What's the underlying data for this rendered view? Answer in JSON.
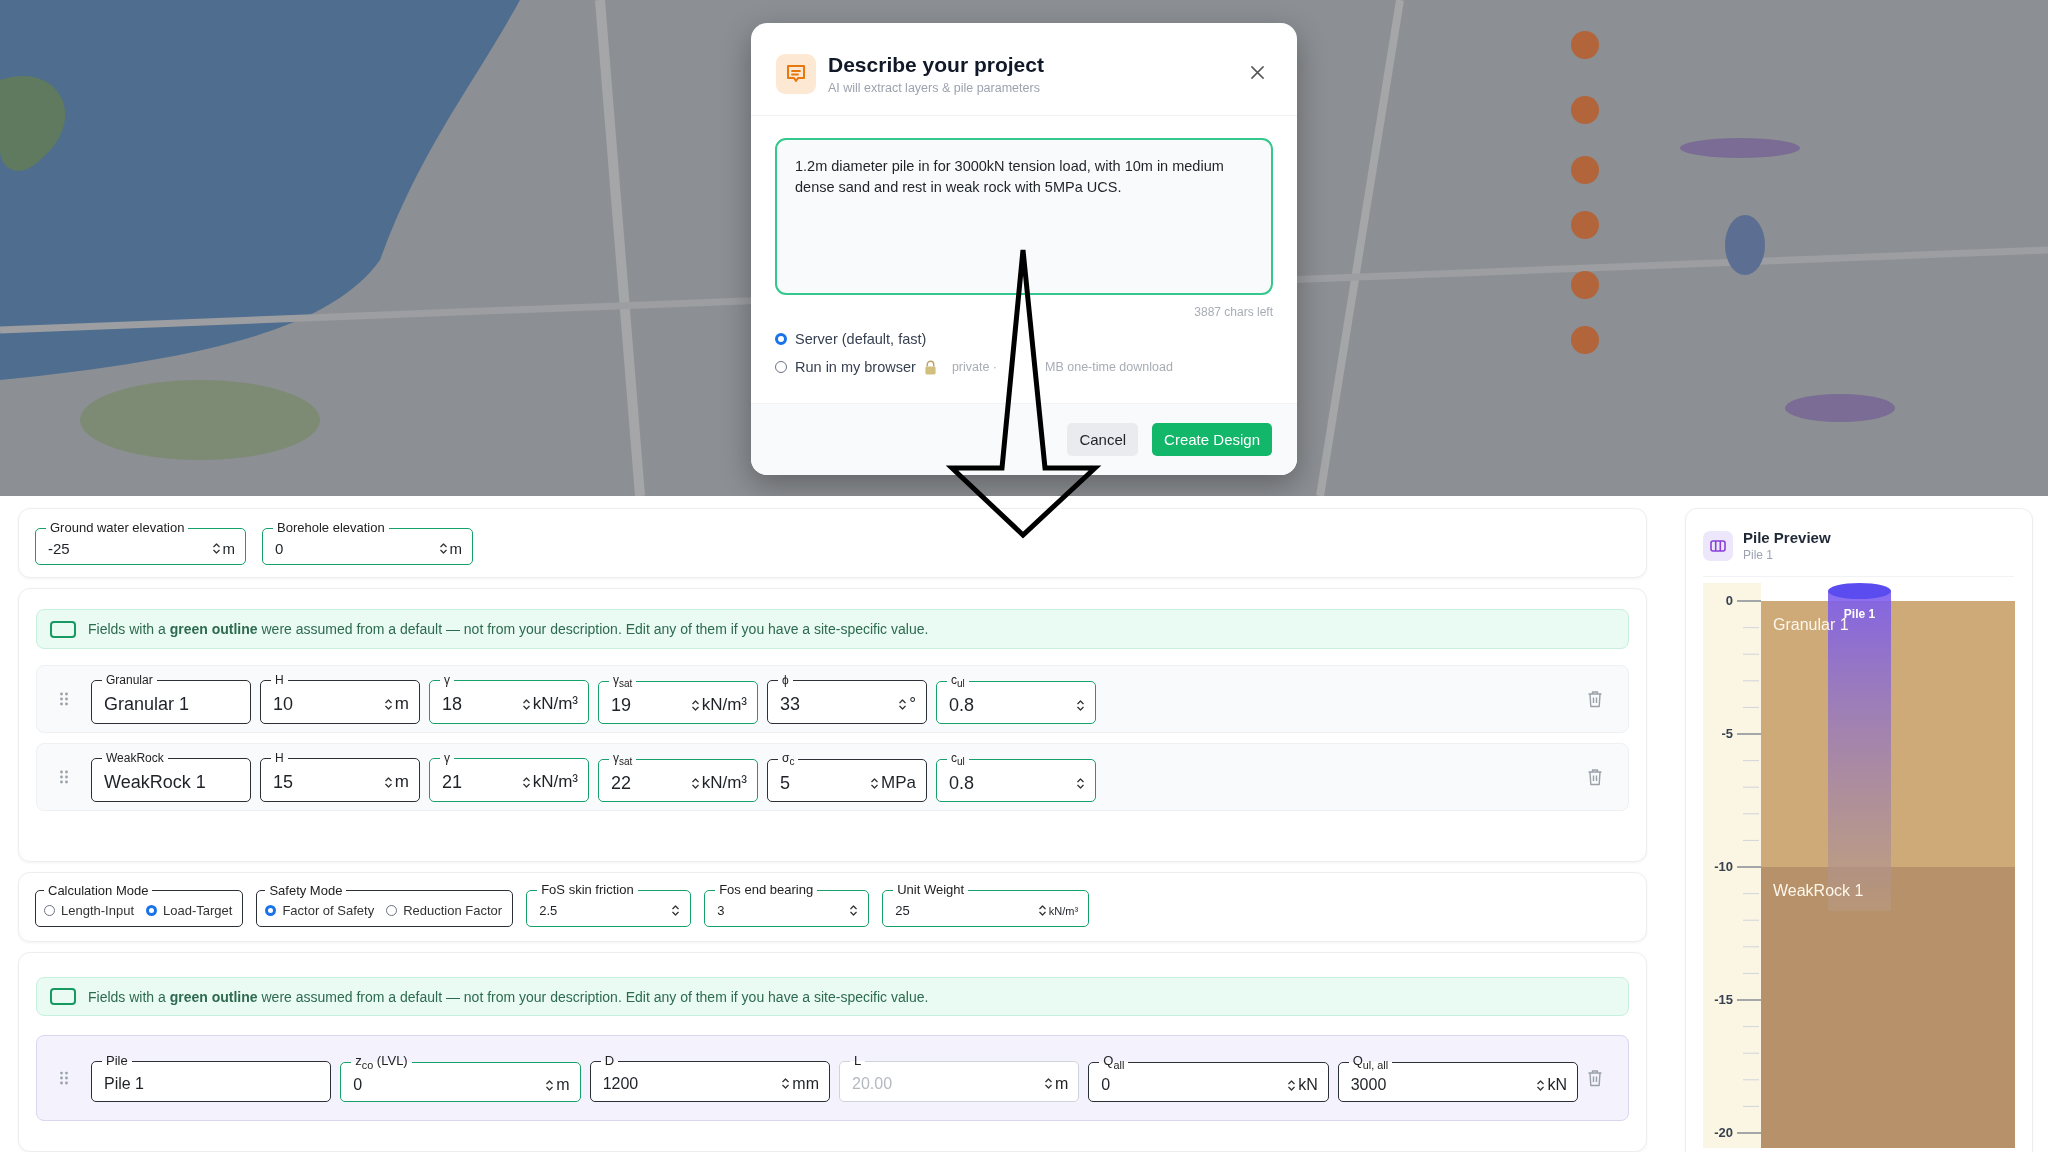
{
  "dialog": {
    "title": "Describe your project",
    "subtitle": "AI will extract layers & pile parameters",
    "description": "1.2m diameter pile in for 3000kN tension load, with 10m in medium dense sand and rest in weak rock with 5MPa UCS.",
    "chars_left": "3887 chars left",
    "run_options": [
      {
        "label": "Server (default, fast)",
        "selected": true,
        "locked": false
      },
      {
        "label": "Run in my browser",
        "selected": false,
        "locked": true,
        "hints": [
          "private ·",
          "MB one-time download"
        ]
      }
    ],
    "buttons": [
      {
        "label": "Cancel",
        "kind": "secondary"
      },
      {
        "label": "Create Design",
        "kind": "primary"
      }
    ]
  },
  "site": {
    "fields": [
      {
        "kind": "number",
        "label": "Ground water elevation",
        "value": "-25",
        "unit": "m",
        "assumed": true
      },
      {
        "kind": "number",
        "label": "Borehole elevation",
        "value": "0",
        "unit": "m",
        "assumed": true
      }
    ]
  },
  "layers": {
    "notice": "Fields with a **green outline** were assumed from a default — not from your description. Edit any of them if you have a site-specific value.",
    "rows": [
      {
        "fields": [
          {
            "kind": "text",
            "label": "Granular",
            "value": "Granular 1",
            "assumed": false
          },
          {
            "kind": "number",
            "label": "H",
            "value": "10",
            "unit": "m",
            "assumed": false
          },
          {
            "kind": "number",
            "label": "γ",
            "value": "18",
            "unit": "kN/m³",
            "assumed": true
          },
          {
            "kind": "number",
            "label": "γ$_{sat}$",
            "value": "19",
            "unit": "kN/m³",
            "assumed": true
          },
          {
            "kind": "number",
            "label": "ϕ",
            "value": "33",
            "unit": "°",
            "assumed": false
          },
          {
            "kind": "number",
            "label": "c$_{ul}$",
            "value": "0.8",
            "assumed": true
          }
        ]
      },
      {
        "fields": [
          {
            "kind": "text",
            "label": "WeakRock",
            "value": "WeakRock 1",
            "assumed": false
          },
          {
            "kind": "number",
            "label": "H",
            "value": "15",
            "unit": "m",
            "assumed": false
          },
          {
            "kind": "number",
            "label": "γ",
            "value": "21",
            "unit": "kN/m³",
            "assumed": true
          },
          {
            "kind": "number",
            "label": "γ$_{sat}$",
            "value": "22",
            "unit": "kN/m³",
            "assumed": true
          },
          {
            "kind": "number",
            "label": "σ$_{c}$",
            "value": "5",
            "unit": "MPa",
            "assumed": false
          },
          {
            "kind": "number",
            "label": "c$_{ul}$",
            "value": "0.8",
            "assumed": true
          }
        ]
      }
    ]
  },
  "settings": {
    "controls": [
      {
        "kind": "radio",
        "label": "Calculation Mode",
        "options": [
          {
            "label": "Length-Input",
            "selected": false
          },
          {
            "label": "Load-Target",
            "selected": true
          }
        ]
      },
      {
        "kind": "radio",
        "label": "Safety Mode",
        "options": [
          {
            "label": "Factor of Safety",
            "selected": true
          },
          {
            "label": "Reduction Factor",
            "selected": false
          }
        ]
      },
      {
        "kind": "number",
        "label": "FoS skin friction",
        "value": "2.5",
        "assumed": true
      },
      {
        "kind": "number",
        "label": "Fos end bearing",
        "value": "3",
        "assumed": true
      },
      {
        "kind": "number",
        "label": "Unit Weight",
        "value": "25",
        "unit": "kN/m³",
        "assumed": true
      }
    ]
  },
  "piles": {
    "notice": "Fields with a **green outline** were assumed from a default — not from your description. Edit any of them if you have a site-specific value.",
    "rows": [
      {
        "fields": [
          {
            "kind": "text",
            "label": "Pile",
            "value": "Pile 1",
            "assumed": false,
            "disabled": false
          },
          {
            "kind": "number",
            "label": "z$_{co}$ (LVL)",
            "value": "0",
            "unit": "m",
            "assumed": true,
            "disabled": false
          },
          {
            "kind": "number",
            "label": "D",
            "value": "1200",
            "unit": "mm",
            "assumed": false,
            "disabled": false
          },
          {
            "kind": "number",
            "label": "L",
            "value": "20.00",
            "unit": "m",
            "assumed": false,
            "disabled": true
          },
          {
            "kind": "number",
            "label": "Q$_{all}$",
            "value": "0",
            "unit": "kN",
            "assumed": false,
            "disabled": false
          },
          {
            "kind": "number",
            "label": "Q$_{ul, all}$",
            "value": "3000",
            "unit": "kN",
            "assumed": false,
            "disabled": false
          }
        ]
      }
    ]
  },
  "preview": {
    "title": "Pile Preview",
    "subtitle": "Pile 1",
    "ticks": [
      "0",
      "-5",
      "-10",
      "-15",
      "-20"
    ],
    "pile_label": "Pile 1",
    "layers": [
      {
        "name": "Granular 1",
        "color": "#cdaa78"
      },
      {
        "name": "WeakRock 1",
        "color": "#b7916a"
      }
    ]
  }
}
